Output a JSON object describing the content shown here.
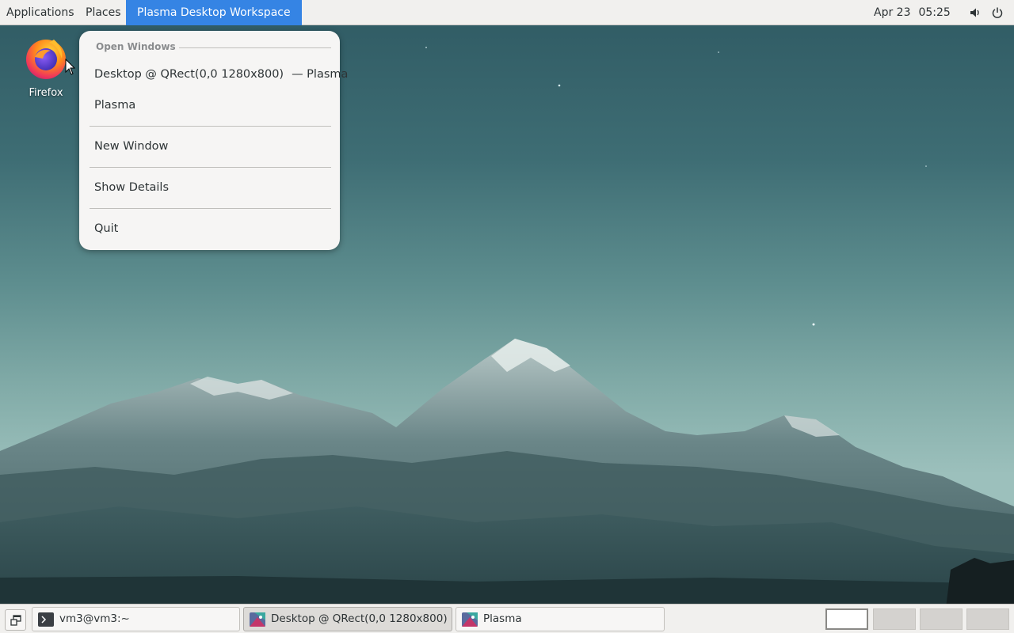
{
  "top_panel": {
    "applications_label": "Applications",
    "places_label": "Places",
    "active_app_label": "Plasma Desktop Workspace",
    "date": "Apr 23",
    "time": "05:25",
    "icons": [
      "volume-icon",
      "power-icon"
    ]
  },
  "desktop": {
    "icons": [
      {
        "label": "Firefox",
        "icon": "firefox-icon"
      }
    ]
  },
  "window_menu": {
    "section_header": "Open Windows",
    "items": [
      {
        "label": "Desktop @ QRect(0,0 1280x800)",
        "suffix": "— Plasma"
      },
      {
        "label": "Plasma"
      },
      {
        "label": "New Window"
      },
      {
        "label": "Show Details"
      },
      {
        "label": "Quit"
      }
    ]
  },
  "taskbar": {
    "tasks": [
      {
        "label": "vm3@vm3:~",
        "icon": "terminal-icon",
        "active": false
      },
      {
        "label": "Desktop @ QRect(0,0 1280x800) ...",
        "icon": "plasma-icon",
        "active": true
      },
      {
        "label": "Plasma",
        "icon": "plasma-icon",
        "active": false
      }
    ],
    "workspaces": 4,
    "active_workspace": 1
  },
  "colors": {
    "accent": "#3584e4",
    "panel_bg": "#f1f0ee",
    "menu_bg": "#f6f5f4"
  }
}
